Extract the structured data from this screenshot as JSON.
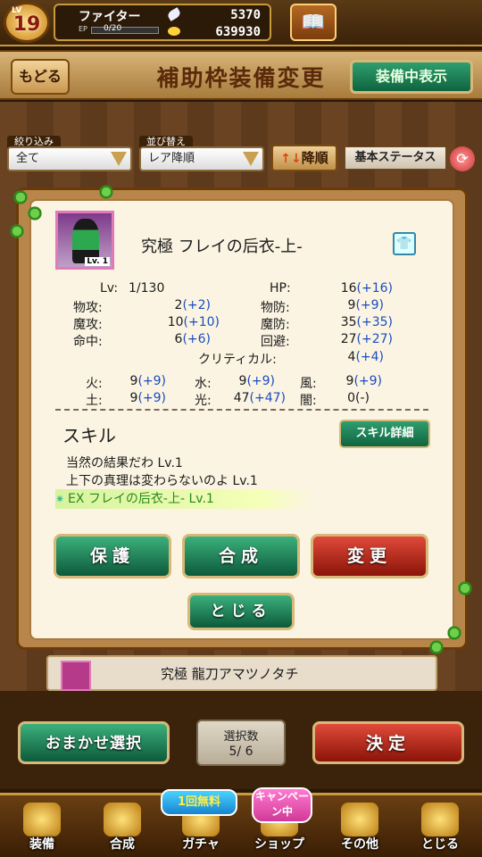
{
  "player": {
    "lv_tag": "LV",
    "level": "19",
    "name": "ファイター",
    "ep_label": "EP",
    "ep_value": "0/20",
    "ep_fraction": 0.0,
    "stones": "5370",
    "gold": "639930"
  },
  "header": {
    "back": "もどる",
    "title": "補助枠装備変更",
    "show_equipped": "装備中表示"
  },
  "filters": {
    "filter_label": "絞り込み",
    "filter_value": "全て",
    "sort_label": "並び替え",
    "sort_value": "レア降順",
    "order_arrow": "↑↓",
    "order": "降順",
    "basic_status": "基本ステータス"
  },
  "item": {
    "name": "究極 フレイの后衣-上-",
    "icon_lv": "Lv. 1",
    "stats": {
      "lv_label": "Lv:",
      "lv": "1/130",
      "hp_label": "HP:",
      "hp": "16",
      "hp_bonus": "(+16)",
      "patk_label": "物攻:",
      "patk": "2",
      "patk_bonus": "(+2)",
      "pdef_label": "物防:",
      "pdef": "9",
      "pdef_bonus": "(+9)",
      "matk_label": "魔攻:",
      "matk": "10",
      "matk_bonus": "(+10)",
      "mdef_label": "魔防:",
      "mdef": "35",
      "mdef_bonus": "(+35)",
      "hit_label": "命中:",
      "hit": "6",
      "hit_bonus": "(+6)",
      "eva_label": "回避:",
      "eva": "27",
      "eva_bonus": "(+27)",
      "crit_label": "クリティカル:",
      "crit": "4",
      "crit_bonus": "(+4)"
    },
    "elements": {
      "fire_label": "火:",
      "fire": "9",
      "fire_bonus": "(+9)",
      "water_label": "水:",
      "water": "9",
      "water_bonus": "(+9)",
      "wind_label": "風:",
      "wind": "9",
      "wind_bonus": "(+9)",
      "earth_label": "土:",
      "earth": "9",
      "earth_bonus": "(+9)",
      "light_label": "光:",
      "light": "47",
      "light_bonus": "(+47)",
      "dark_label": "闇:",
      "dark": "0",
      "dark_bonus": "(-)"
    },
    "skill_title": "スキル",
    "skill_detail": "スキル詳細",
    "skills": [
      "当然の結果だわ  Lv.1",
      "上下の真理は変わらないのよ  Lv.1",
      "EX フレイの后衣-上-  Lv.1"
    ]
  },
  "actions": {
    "protect": "保護",
    "compose": "合成",
    "change": "変更",
    "close": "とじる"
  },
  "list": {
    "next_item": "究極 龍刀アマツノタチ"
  },
  "bottom": {
    "auto": "おまかせ選択",
    "select_label": "選択数",
    "select_value": "5/ 6",
    "decide": "決定"
  },
  "nav": {
    "equip": "装備",
    "compose": "合成",
    "gacha": "ガチャ",
    "shop": "ショップ",
    "other": "その他",
    "close": "とじる",
    "free": "1回無料",
    "campaign": "キャンペーン中"
  }
}
